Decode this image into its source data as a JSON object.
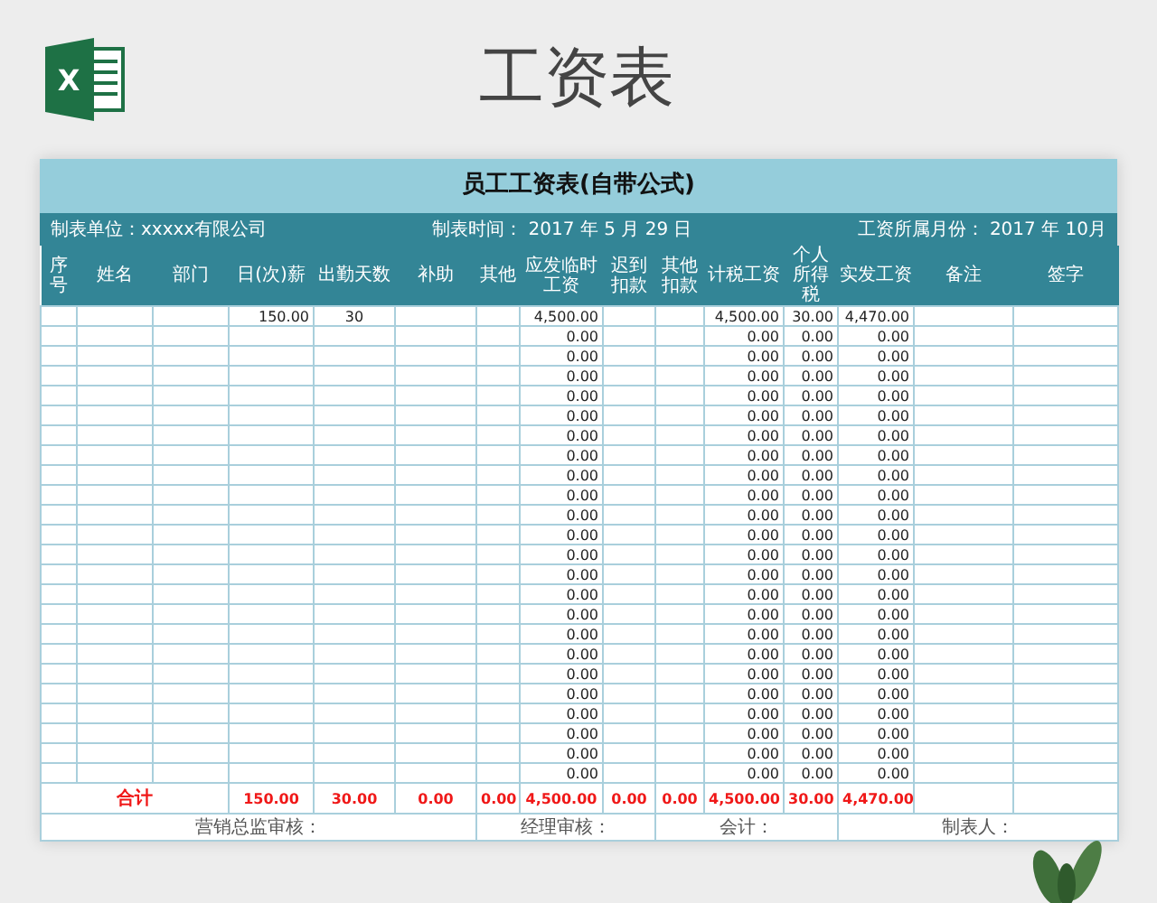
{
  "page": {
    "logo_letter": "X",
    "title": "工资表"
  },
  "sheet": {
    "title": "员工工资表(自带公式)",
    "info": {
      "company": "制表单位：xxxxx有限公司",
      "date": "制表时间： 2017 年 5 月 29 日",
      "month": "工资所属月份： 2017 年 10月"
    },
    "columns": [
      "序号",
      "姓名",
      "部门",
      "日(次)薪",
      "出勤天数",
      "补助",
      "其他",
      "应发临时工资",
      "迟到扣款",
      "其他扣款",
      "计税工资",
      "个人所得税",
      "实发工资",
      "备注",
      "签字"
    ],
    "rows": [
      [
        null,
        null,
        null,
        "150.00",
        "30",
        null,
        null,
        "4,500.00",
        null,
        null,
        "4,500.00",
        "30.00",
        "4,470.00",
        null,
        null
      ],
      [
        null,
        null,
        null,
        null,
        null,
        null,
        null,
        "0.00",
        null,
        null,
        "0.00",
        "0.00",
        "0.00",
        null,
        null
      ],
      [
        null,
        null,
        null,
        null,
        null,
        null,
        null,
        "0.00",
        null,
        null,
        "0.00",
        "0.00",
        "0.00",
        null,
        null
      ],
      [
        null,
        null,
        null,
        null,
        null,
        null,
        null,
        "0.00",
        null,
        null,
        "0.00",
        "0.00",
        "0.00",
        null,
        null
      ],
      [
        null,
        null,
        null,
        null,
        null,
        null,
        null,
        "0.00",
        null,
        null,
        "0.00",
        "0.00",
        "0.00",
        null,
        null
      ],
      [
        null,
        null,
        null,
        null,
        null,
        null,
        null,
        "0.00",
        null,
        null,
        "0.00",
        "0.00",
        "0.00",
        null,
        null
      ],
      [
        null,
        null,
        null,
        null,
        null,
        null,
        null,
        "0.00",
        null,
        null,
        "0.00",
        "0.00",
        "0.00",
        null,
        null
      ],
      [
        null,
        null,
        null,
        null,
        null,
        null,
        null,
        "0.00",
        null,
        null,
        "0.00",
        "0.00",
        "0.00",
        null,
        null
      ],
      [
        null,
        null,
        null,
        null,
        null,
        null,
        null,
        "0.00",
        null,
        null,
        "0.00",
        "0.00",
        "0.00",
        null,
        null
      ],
      [
        null,
        null,
        null,
        null,
        null,
        null,
        null,
        "0.00",
        null,
        null,
        "0.00",
        "0.00",
        "0.00",
        null,
        null
      ],
      [
        null,
        null,
        null,
        null,
        null,
        null,
        null,
        "0.00",
        null,
        null,
        "0.00",
        "0.00",
        "0.00",
        null,
        null
      ],
      [
        null,
        null,
        null,
        null,
        null,
        null,
        null,
        "0.00",
        null,
        null,
        "0.00",
        "0.00",
        "0.00",
        null,
        null
      ],
      [
        null,
        null,
        null,
        null,
        null,
        null,
        null,
        "0.00",
        null,
        null,
        "0.00",
        "0.00",
        "0.00",
        null,
        null
      ],
      [
        null,
        null,
        null,
        null,
        null,
        null,
        null,
        "0.00",
        null,
        null,
        "0.00",
        "0.00",
        "0.00",
        null,
        null
      ],
      [
        null,
        null,
        null,
        null,
        null,
        null,
        null,
        "0.00",
        null,
        null,
        "0.00",
        "0.00",
        "0.00",
        null,
        null
      ],
      [
        null,
        null,
        null,
        null,
        null,
        null,
        null,
        "0.00",
        null,
        null,
        "0.00",
        "0.00",
        "0.00",
        null,
        null
      ],
      [
        null,
        null,
        null,
        null,
        null,
        null,
        null,
        "0.00",
        null,
        null,
        "0.00",
        "0.00",
        "0.00",
        null,
        null
      ],
      [
        null,
        null,
        null,
        null,
        null,
        null,
        null,
        "0.00",
        null,
        null,
        "0.00",
        "0.00",
        "0.00",
        null,
        null
      ],
      [
        null,
        null,
        null,
        null,
        null,
        null,
        null,
        "0.00",
        null,
        null,
        "0.00",
        "0.00",
        "0.00",
        null,
        null
      ],
      [
        null,
        null,
        null,
        null,
        null,
        null,
        null,
        "0.00",
        null,
        null,
        "0.00",
        "0.00",
        "0.00",
        null,
        null
      ],
      [
        null,
        null,
        null,
        null,
        null,
        null,
        null,
        "0.00",
        null,
        null,
        "0.00",
        "0.00",
        "0.00",
        null,
        null
      ],
      [
        null,
        null,
        null,
        null,
        null,
        null,
        null,
        "0.00",
        null,
        null,
        "0.00",
        "0.00",
        "0.00",
        null,
        null
      ],
      [
        null,
        null,
        null,
        null,
        null,
        null,
        null,
        "0.00",
        null,
        null,
        "0.00",
        "0.00",
        "0.00",
        null,
        null
      ],
      [
        null,
        null,
        null,
        null,
        null,
        null,
        null,
        "0.00",
        null,
        null,
        "0.00",
        "0.00",
        "0.00",
        null,
        null
      ]
    ],
    "totals": {
      "label": "合计",
      "values": [
        "150.00",
        "30.00",
        "0.00",
        "0.00",
        "4,500.00",
        "0.00",
        "0.00",
        "4,500.00",
        "30.00",
        "4,470.00"
      ]
    },
    "signatures": [
      "营销总监审核：",
      "经理审核：",
      "会计：",
      "制表人："
    ]
  }
}
